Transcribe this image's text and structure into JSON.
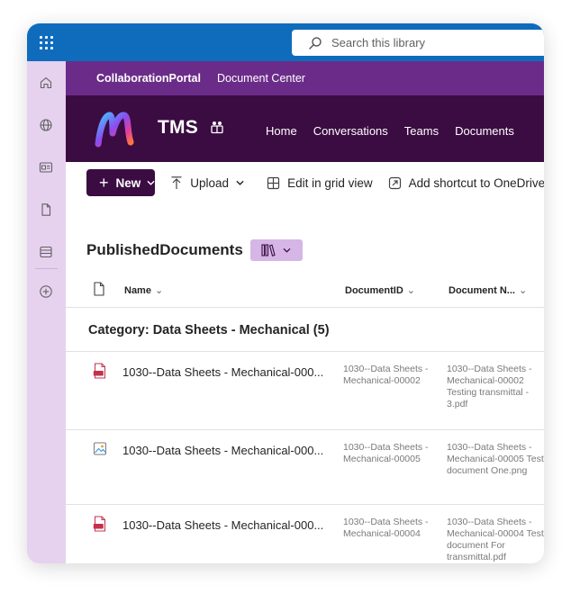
{
  "suitebar": {
    "search_placeholder": "Search this library",
    "color": "#0f6cbd"
  },
  "hub": {
    "title": "CollaborationPortal",
    "link": "Document Center",
    "color": "#6b2c89"
  },
  "site": {
    "title": "TMS",
    "nav": [
      "Home",
      "Conversations",
      "Teams",
      "Documents"
    ],
    "color": "#3b0c42"
  },
  "commandbar": {
    "new_label": "New",
    "upload_label": "Upload",
    "grid_label": "Edit in grid view",
    "shortcut_label": "Add shortcut to OneDrive"
  },
  "library": {
    "title": "PublishedDocuments"
  },
  "columns": {
    "name": "Name",
    "document_id": "DocumentID",
    "document_name": "Document N..."
  },
  "group": {
    "label": "Category: Data Sheets - Mechanical (5)"
  },
  "rows": [
    {
      "icon": "pdf-file-icon",
      "name": "1030--Data Sheets - Mechanical-000...",
      "document_id": "1030--Data Sheets - Mechanical-00002",
      "document_name": "1030--Data Sheets - Mechanical-00002 Testing transmittal - 3.pdf"
    },
    {
      "icon": "image-file-icon",
      "name": "1030--Data Sheets - Mechanical-000...",
      "document_id": "1030--Data Sheets - Mechanical-00005",
      "document_name": "1030--Data Sheets - Mechanical-00005 Test document One.png"
    },
    {
      "icon": "pdf-file-icon",
      "name": "1030--Data Sheets - Mechanical-000...",
      "document_id": "1030--Data Sheets - Mechanical-00004",
      "document_name": "1030--Data Sheets - Mechanical-00004 Test document For transmittal.pdf"
    }
  ]
}
